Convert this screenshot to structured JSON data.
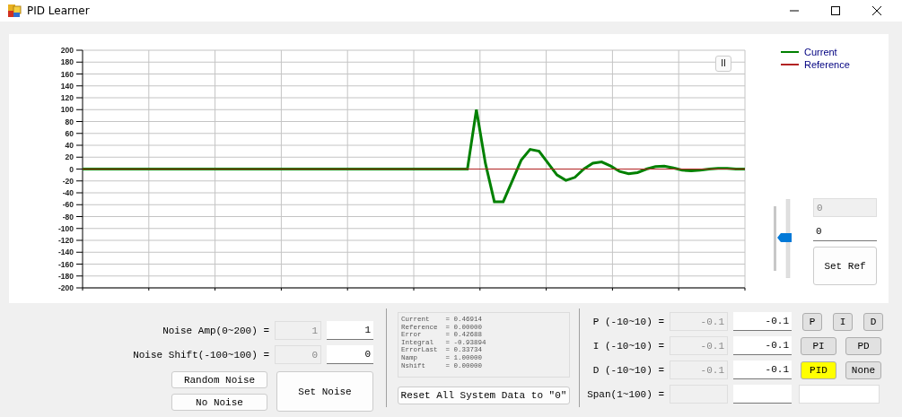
{
  "window": {
    "title": "PID Learner"
  },
  "chart": {
    "pause_button": "II",
    "chart_data": {
      "type": "line",
      "ylim": [
        -200,
        200
      ],
      "grid": true,
      "yticks": [
        200,
        180,
        160,
        140,
        120,
        100,
        80,
        60,
        40,
        20,
        0,
        -20,
        -40,
        -60,
        -80,
        -100,
        -120,
        -140,
        -160,
        -180,
        -200
      ],
      "series": [
        {
          "name": "Current",
          "color": "#008000",
          "values": [
            0,
            0,
            0,
            0,
            0,
            0,
            0,
            0,
            0,
            0,
            0,
            0,
            0,
            0,
            0,
            0,
            0,
            0,
            0,
            0,
            0,
            0,
            0,
            0,
            0,
            0,
            0,
            0,
            0,
            0,
            0,
            0,
            0,
            0,
            0,
            0,
            0,
            0,
            0,
            0,
            0,
            0,
            0,
            0,
            100,
            10,
            -55,
            -55,
            -20,
            15,
            33,
            30,
            10,
            -10,
            -19,
            -14,
            0,
            10,
            12,
            5,
            -4,
            -8,
            -6,
            0,
            4,
            5,
            2,
            -2,
            -3,
            -2,
            0,
            1,
            1,
            0,
            0
          ]
        },
        {
          "name": "Reference",
          "color": "#b22222",
          "values": [
            0,
            0,
            0,
            0,
            0,
            0,
            0,
            0,
            0,
            0,
            0,
            0,
            0,
            0,
            0,
            0,
            0,
            0,
            0,
            0,
            0,
            0,
            0,
            0,
            0,
            0,
            0,
            0,
            0,
            0,
            0,
            0,
            0,
            0,
            0,
            0,
            0,
            0,
            0,
            0,
            0,
            0,
            0,
            0,
            0,
            0,
            0,
            0,
            0,
            0,
            0,
            0,
            0,
            0,
            0,
            0,
            0,
            0,
            0,
            0,
            0,
            0,
            0,
            0,
            0,
            0,
            0,
            0,
            0,
            0,
            0,
            0,
            0,
            0,
            0
          ]
        }
      ]
    }
  },
  "reference": {
    "slider": {
      "level": 0.5
    },
    "current": "0",
    "value": "0",
    "button": "Set Ref"
  },
  "noise": {
    "params": [
      {
        "label": "Noise Amp(0~200) =",
        "current": "1",
        "value": "1"
      },
      {
        "label": "Noise Shift(-100~100) =",
        "current": "0",
        "value": "0"
      }
    ],
    "random_button": "Random Noise",
    "none_button": "No Noise",
    "set_button": "Set Noise"
  },
  "status": {
    "lines": [
      "Current    = 0.46914",
      "Reference  = 0.00000",
      "Error      = 0.42688",
      "Integral   = -0.93894",
      "ErrorLast  = 0.33734",
      "Namp       = 1.00000",
      "Nshift     = 0.00000"
    ],
    "reset_button": "Reset All System Data to \"0\""
  },
  "pid": {
    "params": [
      {
        "label": "P (-10~10) =",
        "current": "-0.1",
        "value": "-0.1"
      },
      {
        "label": "I (-10~10) =",
        "current": "-0.1",
        "value": "-0.1"
      },
      {
        "label": "D (-10~10) =",
        "current": "-0.1",
        "value": "-0.1"
      },
      {
        "label": "Span(1~100) ="
      }
    ],
    "modes": [
      {
        "label": "P",
        "selected": false
      },
      {
        "label": "I",
        "selected": false
      },
      {
        "label": "D",
        "selected": false
      },
      {
        "label": "PI",
        "selected": false
      },
      {
        "label": "PD",
        "selected": false
      },
      {
        "label": "PID",
        "selected": true
      },
      {
        "label": "None",
        "selected": false
      }
    ]
  }
}
